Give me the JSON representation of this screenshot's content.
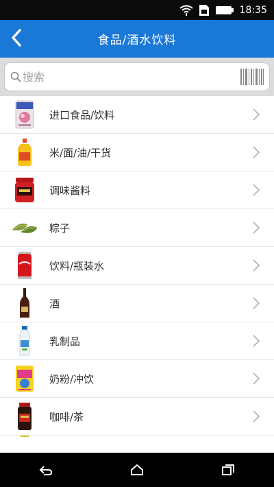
{
  "status_bar": {
    "time": "18:35"
  },
  "header": {
    "title": "食品/酒水饮料"
  },
  "search": {
    "placeholder": "搜索"
  },
  "list": {
    "items": [
      {
        "label": "进口食品/饮料",
        "icon": "imported-food-icon"
      },
      {
        "label": "米/面/油/干货",
        "icon": "oil-bottle-icon"
      },
      {
        "label": "调味酱料",
        "icon": "sauce-jar-icon"
      },
      {
        "label": "粽子",
        "icon": "zongzi-icon"
      },
      {
        "label": "饮料/瓶装水",
        "icon": "soda-can-icon"
      },
      {
        "label": "酒",
        "icon": "wine-bottle-icon"
      },
      {
        "label": "乳制品",
        "icon": "milk-bottle-icon"
      },
      {
        "label": "奶粉/冲饮",
        "icon": "milk-powder-icon"
      },
      {
        "label": "咖啡/茶",
        "icon": "coffee-jar-icon"
      }
    ]
  },
  "colors": {
    "header": "#1a78d7",
    "status_bar": "#0b0b0b",
    "nav_bar": "#000000"
  }
}
